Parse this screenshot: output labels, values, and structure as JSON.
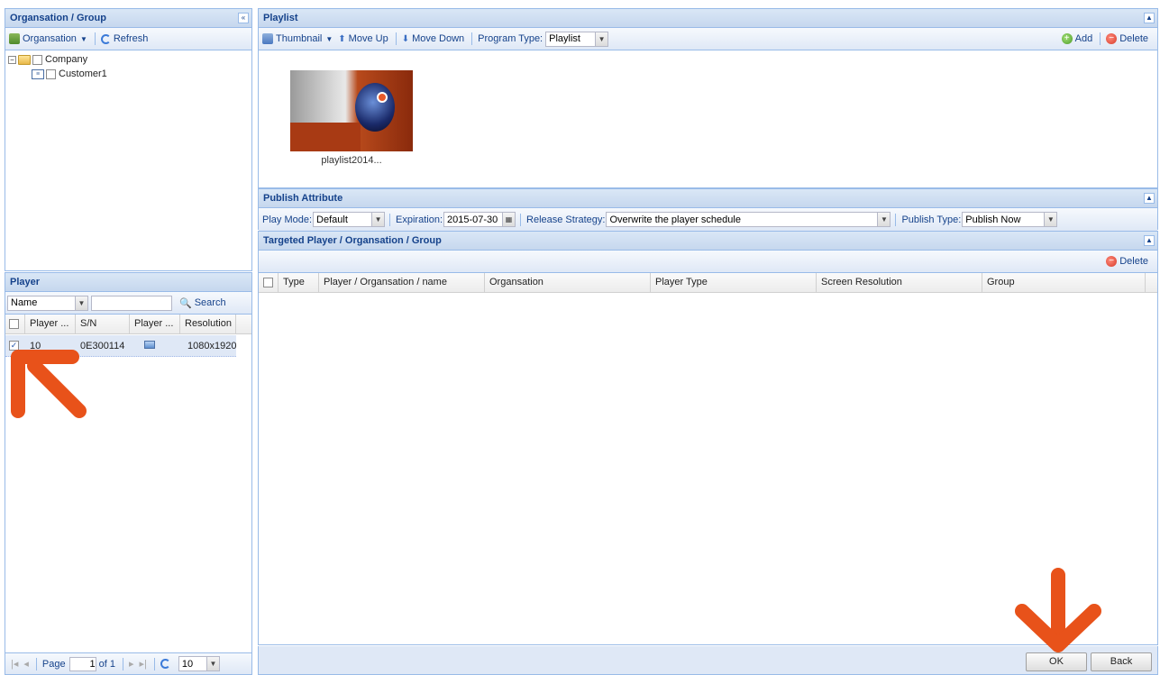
{
  "org_panel": {
    "title": "Organsation / Group",
    "toolbar": {
      "organisation_label": "Organsation",
      "refresh_label": "Refresh"
    },
    "tree": {
      "root_label": "Company",
      "child_label": "Customer1"
    }
  },
  "player_panel": {
    "title": "Player",
    "filter": {
      "field_value": "Name",
      "search_value": "",
      "search_label": "Search"
    },
    "columns": [
      "Player ...",
      "S/N",
      "Player ...",
      "Resolution"
    ],
    "rows": [
      {
        "player": "10",
        "sn": "0E300114",
        "resolution": "1080x1920",
        "checked": true
      }
    ],
    "pager": {
      "page_label": "Page",
      "page_value": "1",
      "of_label": "of 1",
      "page_size": "10"
    }
  },
  "playlist_panel": {
    "title": "Playlist",
    "toolbar": {
      "thumbnail_label": "Thumbnail",
      "move_up_label": "Move Up",
      "move_down_label": "Move Down",
      "program_type_label": "Program Type:",
      "program_type_value": "Playlist",
      "add_label": "Add",
      "delete_label": "Delete"
    },
    "items": [
      {
        "caption": "playlist2014..."
      }
    ]
  },
  "publish_panel": {
    "title": "Publish Attribute",
    "play_mode_label": "Play Mode:",
    "play_mode_value": "Default",
    "expiration_label": "Expiration:",
    "expiration_value": "2015-07-30",
    "release_strategy_label": "Release Strategy:",
    "release_strategy_value": "Overwrite the player schedule",
    "publish_type_label": "Publish Type:",
    "publish_type_value": "Publish Now"
  },
  "target_panel": {
    "title": "Targeted Player / Organsation / Group",
    "delete_label": "Delete",
    "columns": [
      "Type",
      "Player / Organsation / name",
      "Organsation",
      "Player Type",
      "Screen Resolution",
      "Group"
    ]
  },
  "footer": {
    "ok_label": "OK",
    "back_label": "Back"
  },
  "colors": {
    "accent": "#15428b",
    "border": "#99bbe8",
    "arrow": "#e8521a"
  }
}
